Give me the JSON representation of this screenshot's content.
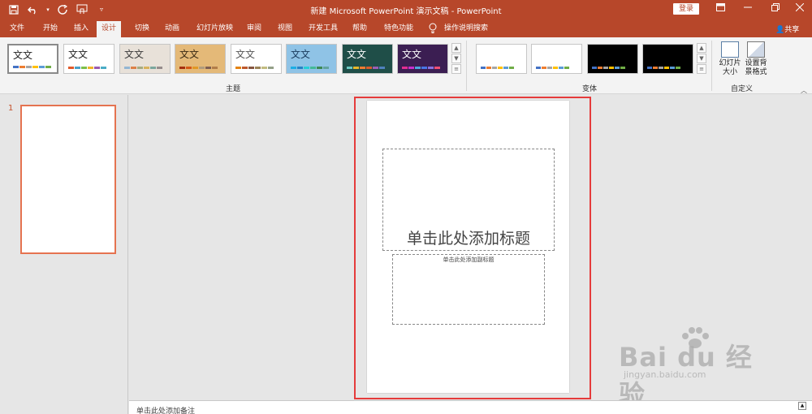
{
  "titlebar": {
    "title": "新建 Microsoft PowerPoint 演示文稿 - PowerPoint",
    "login": "登录",
    "qat_icons": [
      "save-icon",
      "undo-icon",
      "redo-icon",
      "touch-mode-icon",
      "customize-qat-icon"
    ],
    "window_controls": [
      "ribbon-display-options-icon",
      "minimize-icon",
      "restore-icon",
      "close-icon"
    ]
  },
  "tabs": [
    "文件",
    "开始",
    "插入",
    "设计",
    "切换",
    "动画",
    "幻灯片放映",
    "审阅",
    "视图",
    "开发工具",
    "帮助",
    "特色功能"
  ],
  "active_tab": "设计",
  "tell_me": "操作说明搜索",
  "share": "共享",
  "ribbon": {
    "themes_label": "主题",
    "theme_text": "文文",
    "variants_label": "变体",
    "customize_label": "自定义",
    "slide_size": "幻灯片大小",
    "format_bg": "设置背景格式"
  },
  "themes": [
    {
      "bg": "#ffffff",
      "text": "#222222",
      "colors": [
        "#4472c4",
        "#ed7d31",
        "#a5a5a5",
        "#ffc000",
        "#5b9bd5",
        "#70ad47"
      ]
    },
    {
      "bg": "#ffffff",
      "text": "#222222",
      "colors": [
        "#e05a2b",
        "#49a0c8",
        "#7cbf4a",
        "#f0b42c",
        "#9a5bb0",
        "#4bacc6"
      ]
    },
    {
      "bg": "#e8e1d9",
      "text": "#3a3a3a",
      "colors": [
        "#94b6d2",
        "#dd8047",
        "#a5ab81",
        "#d8b25c",
        "#7ba79d",
        "#968c8c"
      ]
    },
    {
      "bg": "#e4b978",
      "text": "#3a2a14",
      "colors": [
        "#a5300f",
        "#d55816",
        "#e19825",
        "#b19c7d",
        "#7f5f52",
        "#b27d49"
      ]
    },
    {
      "bg": "#ffffff",
      "text": "#555555",
      "colors": [
        "#e48312",
        "#bd582c",
        "#865640",
        "#9b8357",
        "#c2bc80",
        "#94a088"
      ]
    },
    {
      "bg": "#8fc3e6",
      "text": "#1a3b5c",
      "colors": [
        "#1cade4",
        "#2683c6",
        "#27ced7",
        "#42ba97",
        "#3e8853",
        "#62a39f"
      ]
    },
    {
      "bg": "#1f4e48",
      "text": "#ffffff",
      "colors": [
        "#6ac7c0",
        "#e6b729",
        "#ee7b31",
        "#d65c2c",
        "#9c5db5",
        "#4f81bd"
      ]
    },
    {
      "bg": "#3b1e52",
      "text": "#ffffff",
      "colors": [
        "#e32d91",
        "#c830cc",
        "#4ea6dc",
        "#4775e7",
        "#8971e1",
        "#f24e73"
      ]
    }
  ],
  "variants": [
    {
      "bg": "#ffffff",
      "colors": [
        "#4472c4",
        "#ed7d31",
        "#a5a5a5",
        "#ffc000",
        "#5b9bd5",
        "#70ad47"
      ]
    },
    {
      "bg": "#ffffff",
      "colors": [
        "#4472c4",
        "#ed7d31",
        "#a5a5a5",
        "#ffc000",
        "#5b9bd5",
        "#70ad47"
      ]
    },
    {
      "bg": "#000000",
      "colors": [
        "#4472c4",
        "#ed7d31",
        "#a5a5a5",
        "#ffc000",
        "#5b9bd5",
        "#70ad47"
      ]
    },
    {
      "bg": "#000000",
      "colors": [
        "#4472c4",
        "#ed7d31",
        "#a5a5a5",
        "#ffc000",
        "#5b9bd5",
        "#70ad47"
      ]
    }
  ],
  "slides": {
    "current_number": "1"
  },
  "slide": {
    "title_placeholder": "单击此处添加标题",
    "subtitle_placeholder": "单击此处添加副标题"
  },
  "notes": {
    "placeholder": "单击此处添加备注"
  },
  "watermark": {
    "brand": "Bai du 经验",
    "url": "jingyan.baidu.com"
  },
  "colors": {
    "accent": "#b7472a",
    "highlight": "#e53b3b",
    "thumb_border": "#e57350"
  }
}
